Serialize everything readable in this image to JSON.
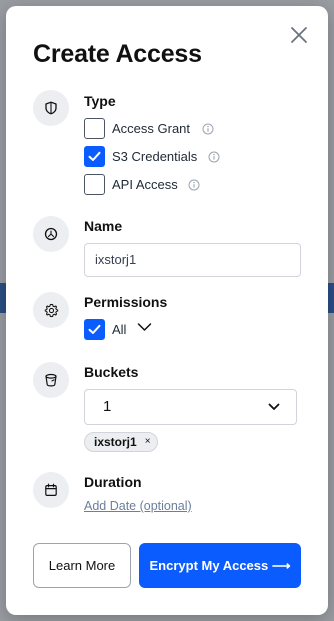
{
  "modal": {
    "title": "Create Access",
    "close_icon": "close-icon"
  },
  "type": {
    "label": "Type",
    "icon": "shield-icon",
    "options": [
      {
        "label": "Access Grant",
        "checked": false
      },
      {
        "label": "S3 Credentials",
        "checked": true
      },
      {
        "label": "API Access",
        "checked": false
      }
    ]
  },
  "name": {
    "label": "Name",
    "icon": "tag-icon",
    "value": "ixstorj1"
  },
  "permissions": {
    "label": "Permissions",
    "icon": "gear-icon",
    "all_label": "All",
    "all_checked": true
  },
  "buckets": {
    "label": "Buckets",
    "icon": "bucket-icon",
    "selected_count": "1",
    "chips": [
      "ixstorj1"
    ]
  },
  "duration": {
    "label": "Duration",
    "icon": "calendar-icon",
    "add_date_link": "Add Date (optional)"
  },
  "actions": {
    "learn_more": "Learn More",
    "encrypt": "Encrypt My Access ⟶"
  },
  "colors": {
    "accent": "#0b5cff",
    "icon_bg": "#eceef1"
  }
}
